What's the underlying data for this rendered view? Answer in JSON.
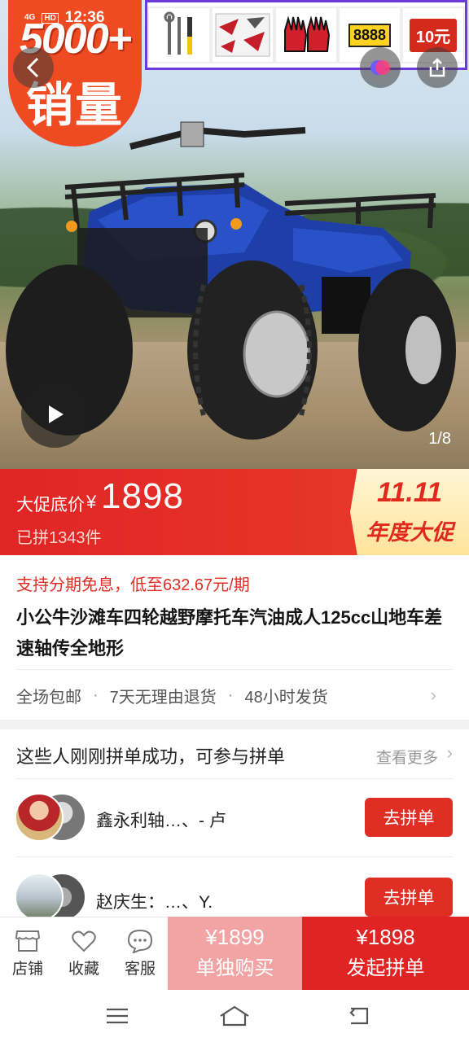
{
  "status_bar": {
    "network": "4G",
    "hd": "HD",
    "time": "12:36"
  },
  "hero": {
    "badge_number": "5000+",
    "badge_label": "销量",
    "accessories": [
      "wrench-set",
      "decal-sticker",
      "racing-gloves",
      "license-plate",
      "red-envelope"
    ],
    "plate_text": "8888",
    "red_card_text": "10元",
    "image_counter": "1/8"
  },
  "price": {
    "promo_label": "大促底价",
    "currency": "¥",
    "amount": "1898",
    "sold": "已拼1343件",
    "event_date": "11.11",
    "event_name": "年度大促"
  },
  "installment": "支持分期免息，低至632.67元/期",
  "title": "小公牛沙滩车四轮越野摩托车汽油成人125cc山地车差速轴传全地形",
  "services": [
    "全场包邮",
    "7天无理由退货",
    "48小时发货"
  ],
  "group_buy": {
    "title": "这些人刚刚拼单成功，可参与拼单",
    "see_more": "查看更多",
    "rows": [
      {
        "name": "鑫永利轴…、- 卢",
        "button": "去拼单"
      },
      {
        "name": "赵庆生：…、Y.",
        "button": "去拼单"
      }
    ]
  },
  "bottom_bar": {
    "store": "店铺",
    "favorite": "收藏",
    "service": "客服",
    "solo_price": "¥1899",
    "solo_label": "单独购买",
    "group_price": "¥1898",
    "group_label": "发起拼单"
  },
  "colors": {
    "accent": "#e02e24",
    "badge": "#ef4b23",
    "event_text": "#e02a1e",
    "solo_button": "#f2a3a3"
  }
}
